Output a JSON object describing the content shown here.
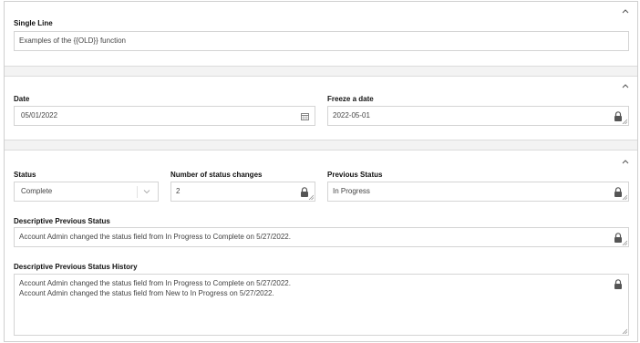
{
  "section1": {
    "single_line": {
      "label": "Single Line",
      "value": "Examples of the {{OLD}} function"
    }
  },
  "section2": {
    "date": {
      "label": "Date",
      "value": "05/01/2022"
    },
    "freeze": {
      "label": "Freeze a date",
      "value": "2022-05-01"
    }
  },
  "section3": {
    "status": {
      "label": "Status",
      "value": "Complete"
    },
    "changes": {
      "label": "Number of status changes",
      "value": "2"
    },
    "previous": {
      "label": "Previous Status",
      "value": "In Progress"
    },
    "descriptive": {
      "label": "Descriptive Previous Status",
      "value": "Account Admin  changed the status field from In Progress to Complete on 5/27/2022."
    },
    "history": {
      "label": "Descriptive Previous Status History",
      "lines": [
        "Account Admin  changed the status field from In Progress to Complete on 5/27/2022.",
        "Account Admin  changed the status field from New to In Progress on 5/27/2022."
      ]
    }
  },
  "icons": {
    "collapse": "chevron-up-icon",
    "lock": "lock-icon",
    "calendar": "calendar-icon",
    "dropdown": "chevron-down-icon",
    "resize": "resize-grip-icon"
  }
}
